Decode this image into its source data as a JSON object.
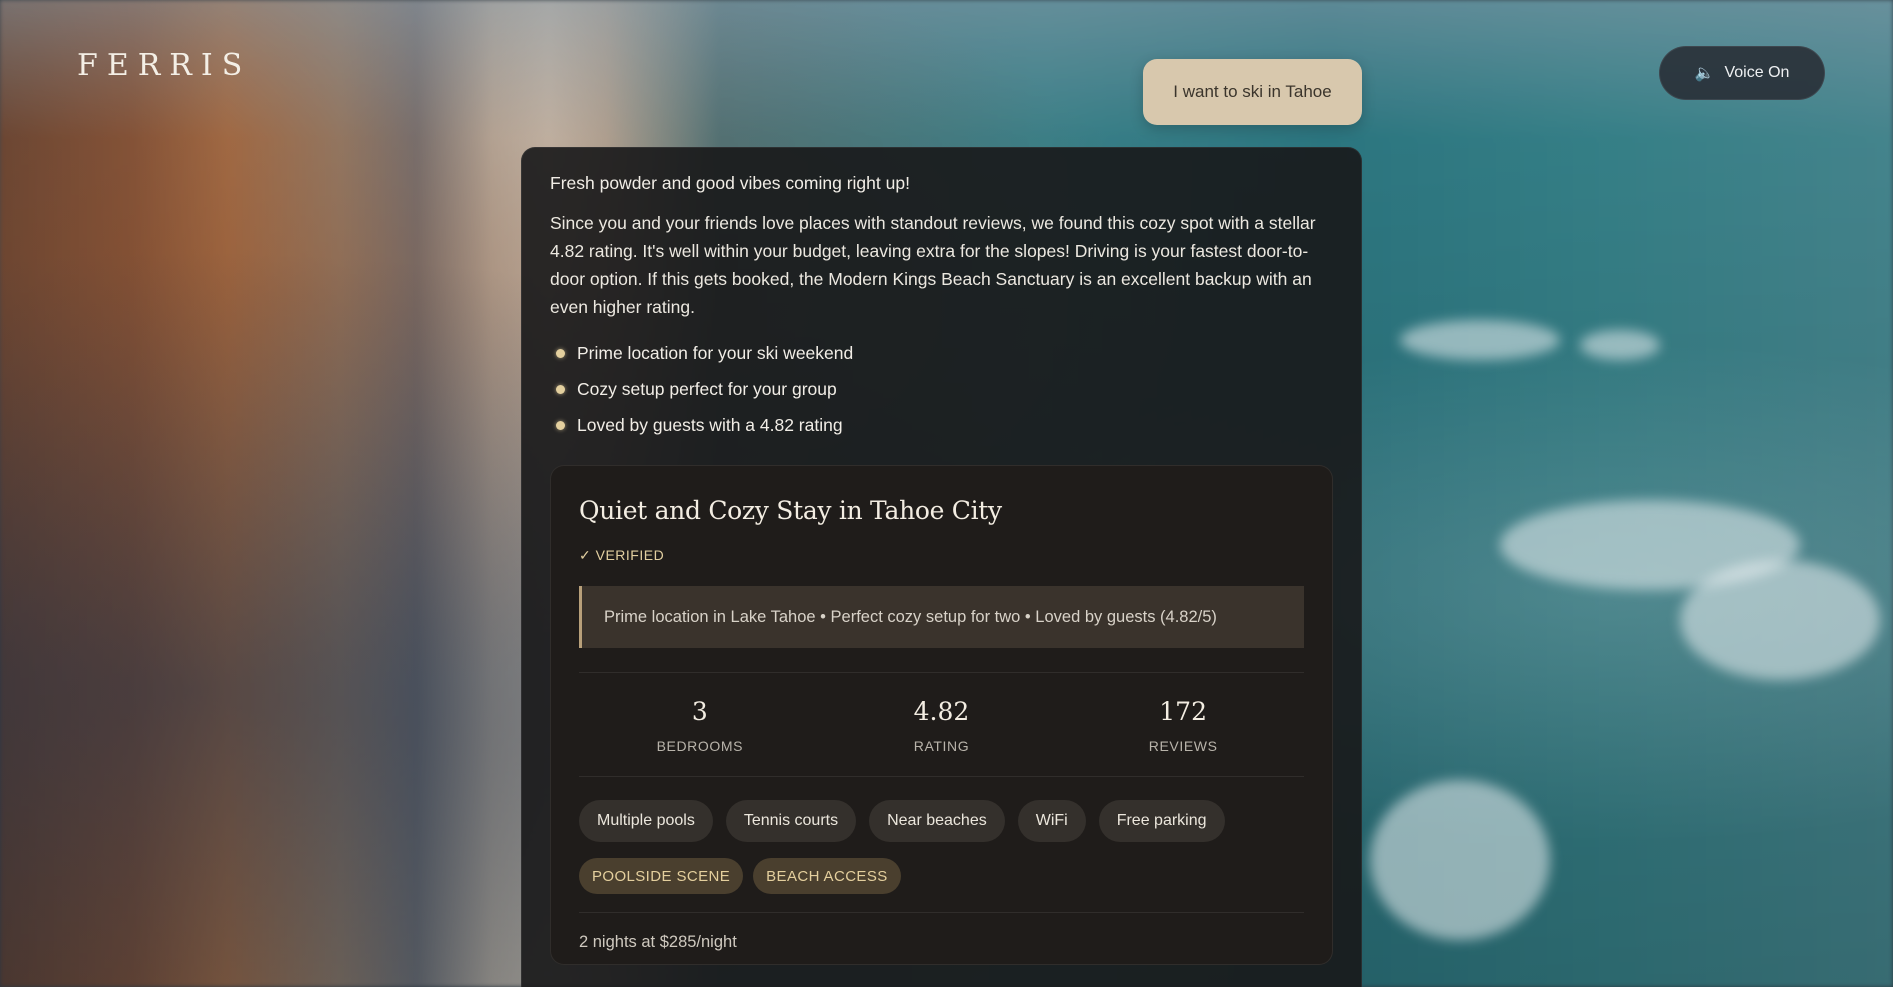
{
  "brand": {
    "logo_text": "FERRIS"
  },
  "voice": {
    "icon": "speaker-icon",
    "label": "Voice On"
  },
  "user_message": "I want to ski in Tahoe",
  "assistant": {
    "greeting": "Fresh powder and good vibes coming right up!",
    "summary": "Since you and your friends love places with standout reviews, we found this cozy spot with a stellar 4.82 rating. It's well within your budget, leaving extra for the slopes! Driving is your fastest door-to-door option. If this gets booked, the Modern Kings Beach Sanctuary is an excellent backup with an even higher rating.",
    "bullets": [
      "Prime location for your ski weekend",
      "Cozy setup perfect for your group",
      "Loved by guests with a 4.82 rating"
    ]
  },
  "listing": {
    "title": "Quiet and Cozy Stay in Tahoe City",
    "verified_label": "✓ VERIFIED",
    "highlights": "Prime location in Lake Tahoe • Perfect cozy setup for two • Loved by guests (4.82/5)",
    "stats": [
      {
        "value": "3",
        "label": "BEDROOMS"
      },
      {
        "value": "4.82",
        "label": "RATING"
      },
      {
        "value": "172",
        "label": "REVIEWS"
      }
    ],
    "amenities": [
      "Multiple pools",
      "Tennis courts",
      "Near beaches",
      "WiFi",
      "Free parking"
    ],
    "tags": [
      "POOLSIDE SCENE",
      "BEACH ACCESS"
    ],
    "price": "2 nights at $285/night"
  },
  "colors": {
    "accent_gold": "#e2cfa0",
    "user_bubble": "#d8c8ad",
    "panel_bg": "#18181a"
  }
}
